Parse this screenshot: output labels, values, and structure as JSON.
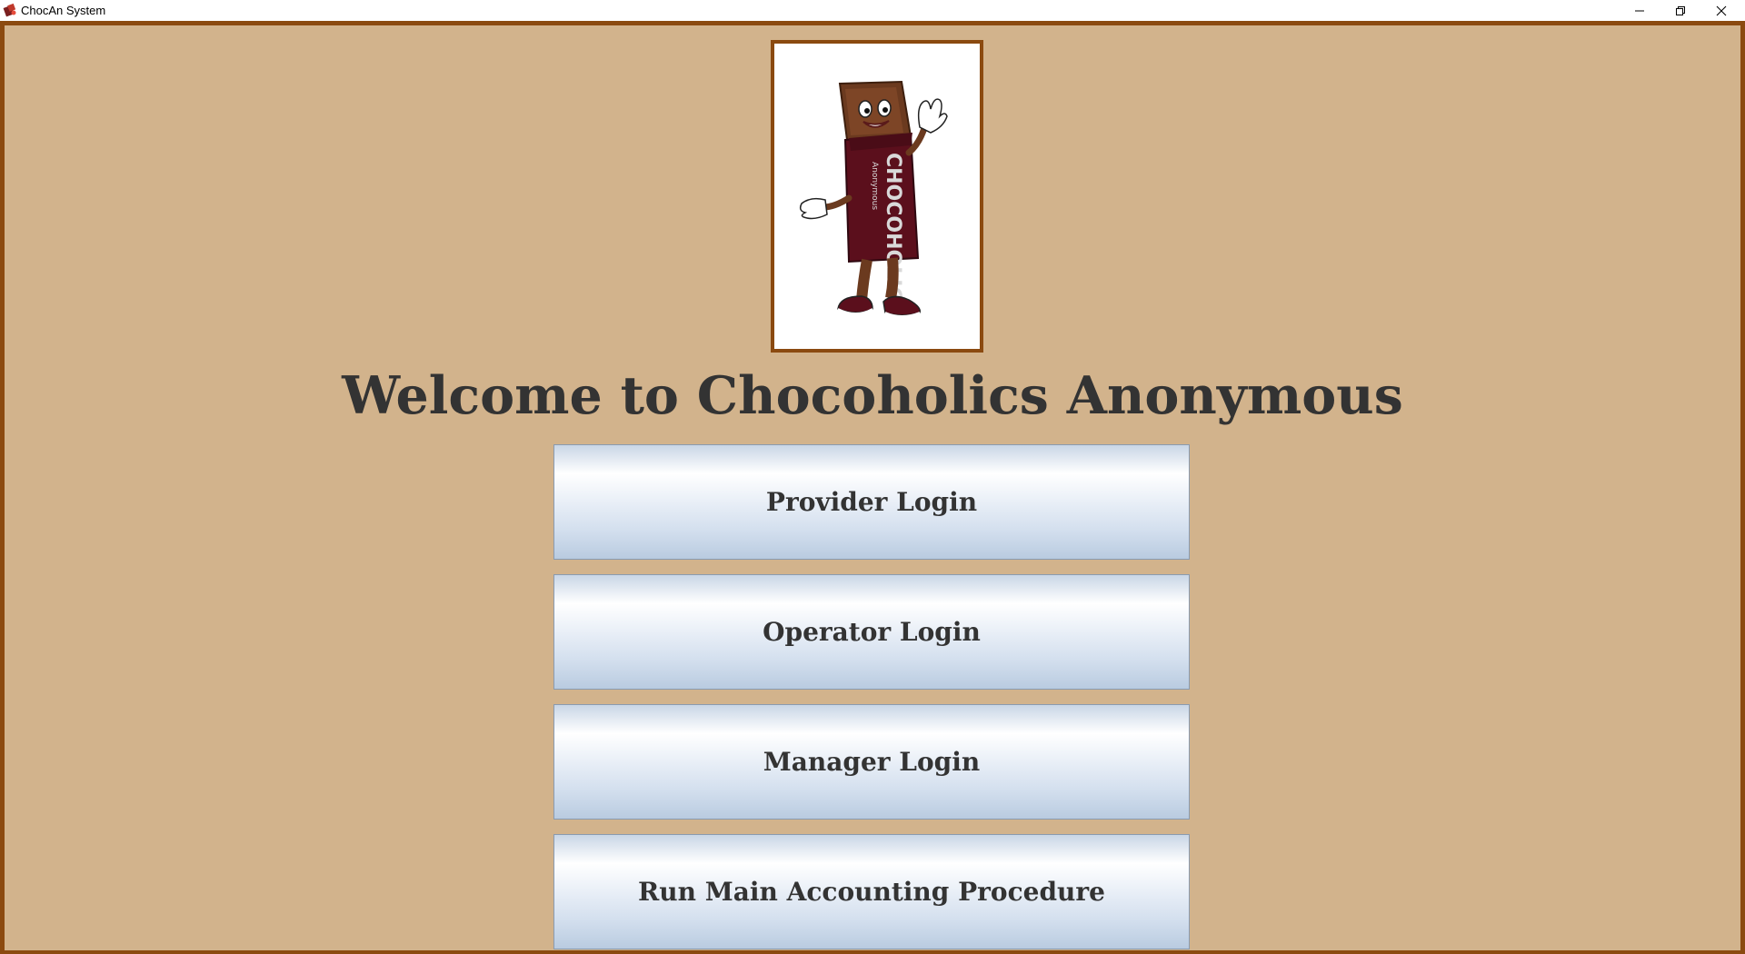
{
  "window": {
    "title": "ChocAn System"
  },
  "main": {
    "welcome_text": "Welcome to Chocoholics Anonymous",
    "mascot": {
      "wrapper_text": "CHOCOHOLICS",
      "wrapper_subtext": "Anonymous"
    }
  },
  "buttons": {
    "provider_login": "Provider Login",
    "operator_login": "Operator Login",
    "manager_login": "Manager Login",
    "accounting": "Run Main Accounting Procedure"
  },
  "colors": {
    "background": "#d2b38c",
    "frame_border": "#8b4a10",
    "text": "#333333"
  }
}
